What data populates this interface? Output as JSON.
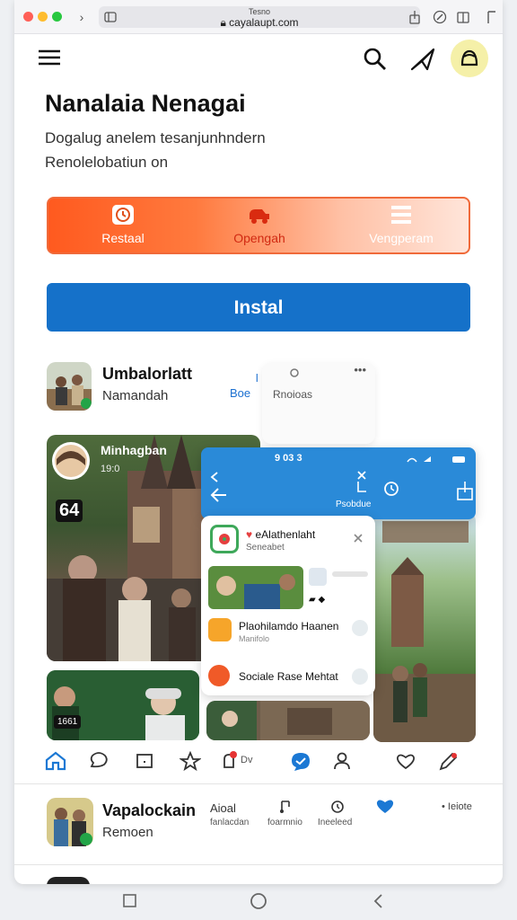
{
  "browser": {
    "tab_title": "Tesno",
    "url": "cayalaupt.com",
    "colors": {
      "close": "#ff5f57",
      "min": "#febc2e",
      "max": "#28c840"
    }
  },
  "appbar": {
    "icons": [
      "menu-icon",
      "search-icon",
      "send-icon",
      "avatar"
    ]
  },
  "header": {
    "title": "Nanalaia Nenagai",
    "subtitle_line1": "Dogalug anelem tesanjunhndern",
    "subtitle_line2": "Renolelobatiun on"
  },
  "segments": [
    {
      "label": "Restaal",
      "icon": "clock-icon"
    },
    {
      "label": "Opengah",
      "icon": "car-icon"
    },
    {
      "label": "Vengperam",
      "icon": "list-icon"
    }
  ],
  "install_label": "Instal",
  "app1": {
    "name": "Umbalorlatt",
    "subtitle": "Namandah",
    "action": "Boe",
    "overlay_label": "Rnoioas",
    "more": "•••"
  },
  "feature_card": {
    "name": "Minhagban",
    "small": "19:0",
    "badge": "64"
  },
  "bottom_tile": {
    "badge": "1661"
  },
  "phone": {
    "time": "9 03 3",
    "label": "Psobdue",
    "app_name": "eAlathenlaht",
    "app_sub": "Seneabet",
    "list": [
      {
        "title": "Plaohilamdo Haanen",
        "sub": "Manifolo"
      },
      {
        "title": "Sociale Rase Mehtat",
        "sub": ""
      }
    ]
  },
  "nav": {
    "label_dv": "Dv"
  },
  "app2": {
    "name": "Vapalockain",
    "subtitle": "Remoen",
    "col1": "Aioal",
    "col1_sub": "fanlacdan",
    "col2_sub": "foarmnio",
    "col3_sub": "Ineeleed",
    "right": "• Ieiote"
  }
}
